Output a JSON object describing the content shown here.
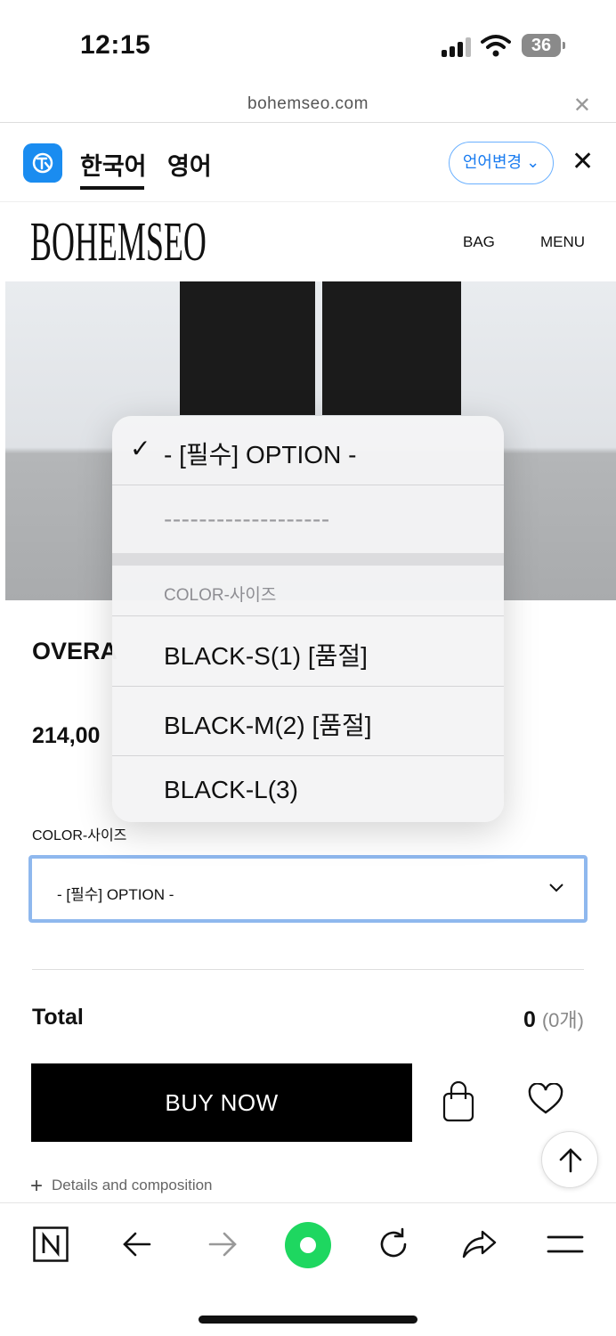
{
  "status_bar": {
    "time": "12:15",
    "battery": "36"
  },
  "url_bar": {
    "url": "bohemseo.com"
  },
  "translate_bar": {
    "lang_primary": "한국어",
    "lang_secondary": "영어",
    "change_button": "언어변경 ⌄"
  },
  "site_header": {
    "logo": "BOHEMSEO",
    "nav_bag": "BAG",
    "nav_menu": "MENU"
  },
  "product": {
    "name": "OVERA",
    "price": "214,00",
    "option_label": "COLOR-사이즈",
    "select_value": "- [필수] OPTION -",
    "total_label": "Total",
    "total_value": "0",
    "total_count": "(0개)",
    "buy_label": "BUY NOW",
    "details_label": "Details and composition"
  },
  "dropdown": {
    "selected_option": "- [필수] OPTION -",
    "separator_option": "-------------------",
    "group_label": "COLOR-사이즈",
    "options": [
      "BLACK-S(1) [품절]",
      "BLACK-M(2) [품절]",
      "BLACK-L(3)"
    ]
  },
  "icons": {
    "check": "checkmark-icon",
    "back": "arrow-left-icon",
    "forward": "arrow-right-icon",
    "reload": "reload-icon",
    "share": "share-icon",
    "menu": "hamburger-icon",
    "naver": "naver-n-icon",
    "green_dot": "green-circle-icon"
  },
  "colors": {
    "accent_blue": "#1a8cf0",
    "green": "#1ed760",
    "buy_bg": "#000000"
  }
}
